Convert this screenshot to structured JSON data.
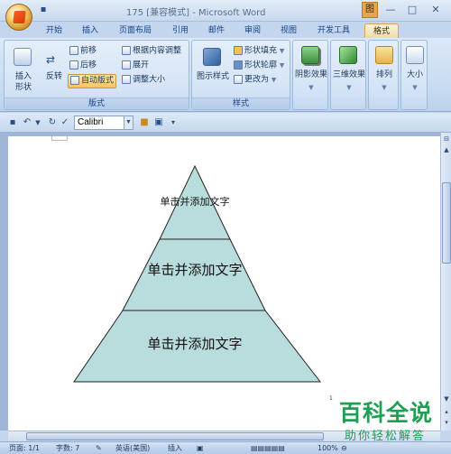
{
  "window": {
    "title": "175 [兼容模式] - Microsoft Word",
    "context_tab_label": "图",
    "minimize": "—",
    "maximize": "□",
    "close": "✕"
  },
  "tabs": [
    {
      "label": "开始",
      "active": false
    },
    {
      "label": "插入",
      "active": false
    },
    {
      "label": "页面布局",
      "active": false
    },
    {
      "label": "引用",
      "active": false
    },
    {
      "label": "邮件",
      "active": false
    },
    {
      "label": "审阅",
      "active": false
    },
    {
      "label": "视图",
      "active": false
    },
    {
      "label": "开发工具",
      "active": false
    },
    {
      "label": "格式",
      "active": true
    }
  ],
  "ribbon": {
    "layout_group": {
      "label": "版式",
      "insert_shape": "插入",
      "insert_shape_2": "形状",
      "reverse": "反转",
      "move_forward": "前移",
      "move_backward": "后移",
      "auto_layout": "自动版式",
      "fit_content": "根据内容调整",
      "expand": "展开",
      "resize": "调整大小"
    },
    "style_group": {
      "label": "样式",
      "diagram_style": "图示样式",
      "shape_fill": "形状填充",
      "shape_outline": "形状轮廓",
      "change_to": "更改为"
    },
    "shadow": "阴影效果",
    "three_d": "三维效果",
    "arrange": "排列",
    "size": "大小"
  },
  "qat": {
    "font_name": "Calibri"
  },
  "diagram": {
    "levels": [
      {
        "text": "单击并添加文字"
      },
      {
        "text": "单击并添加文字"
      },
      {
        "text": "单击并添加文字"
      }
    ],
    "fill_color": "#b9dcdc",
    "stroke_color": "#222222"
  },
  "status": {
    "page": "页面: 1/1",
    "words": "字数: 7",
    "language": "英语(美国)",
    "insert_mode": "插入",
    "zoom": "100%"
  },
  "watermark": {
    "title": "百科全说",
    "subtitle": "助你轻松解答"
  }
}
